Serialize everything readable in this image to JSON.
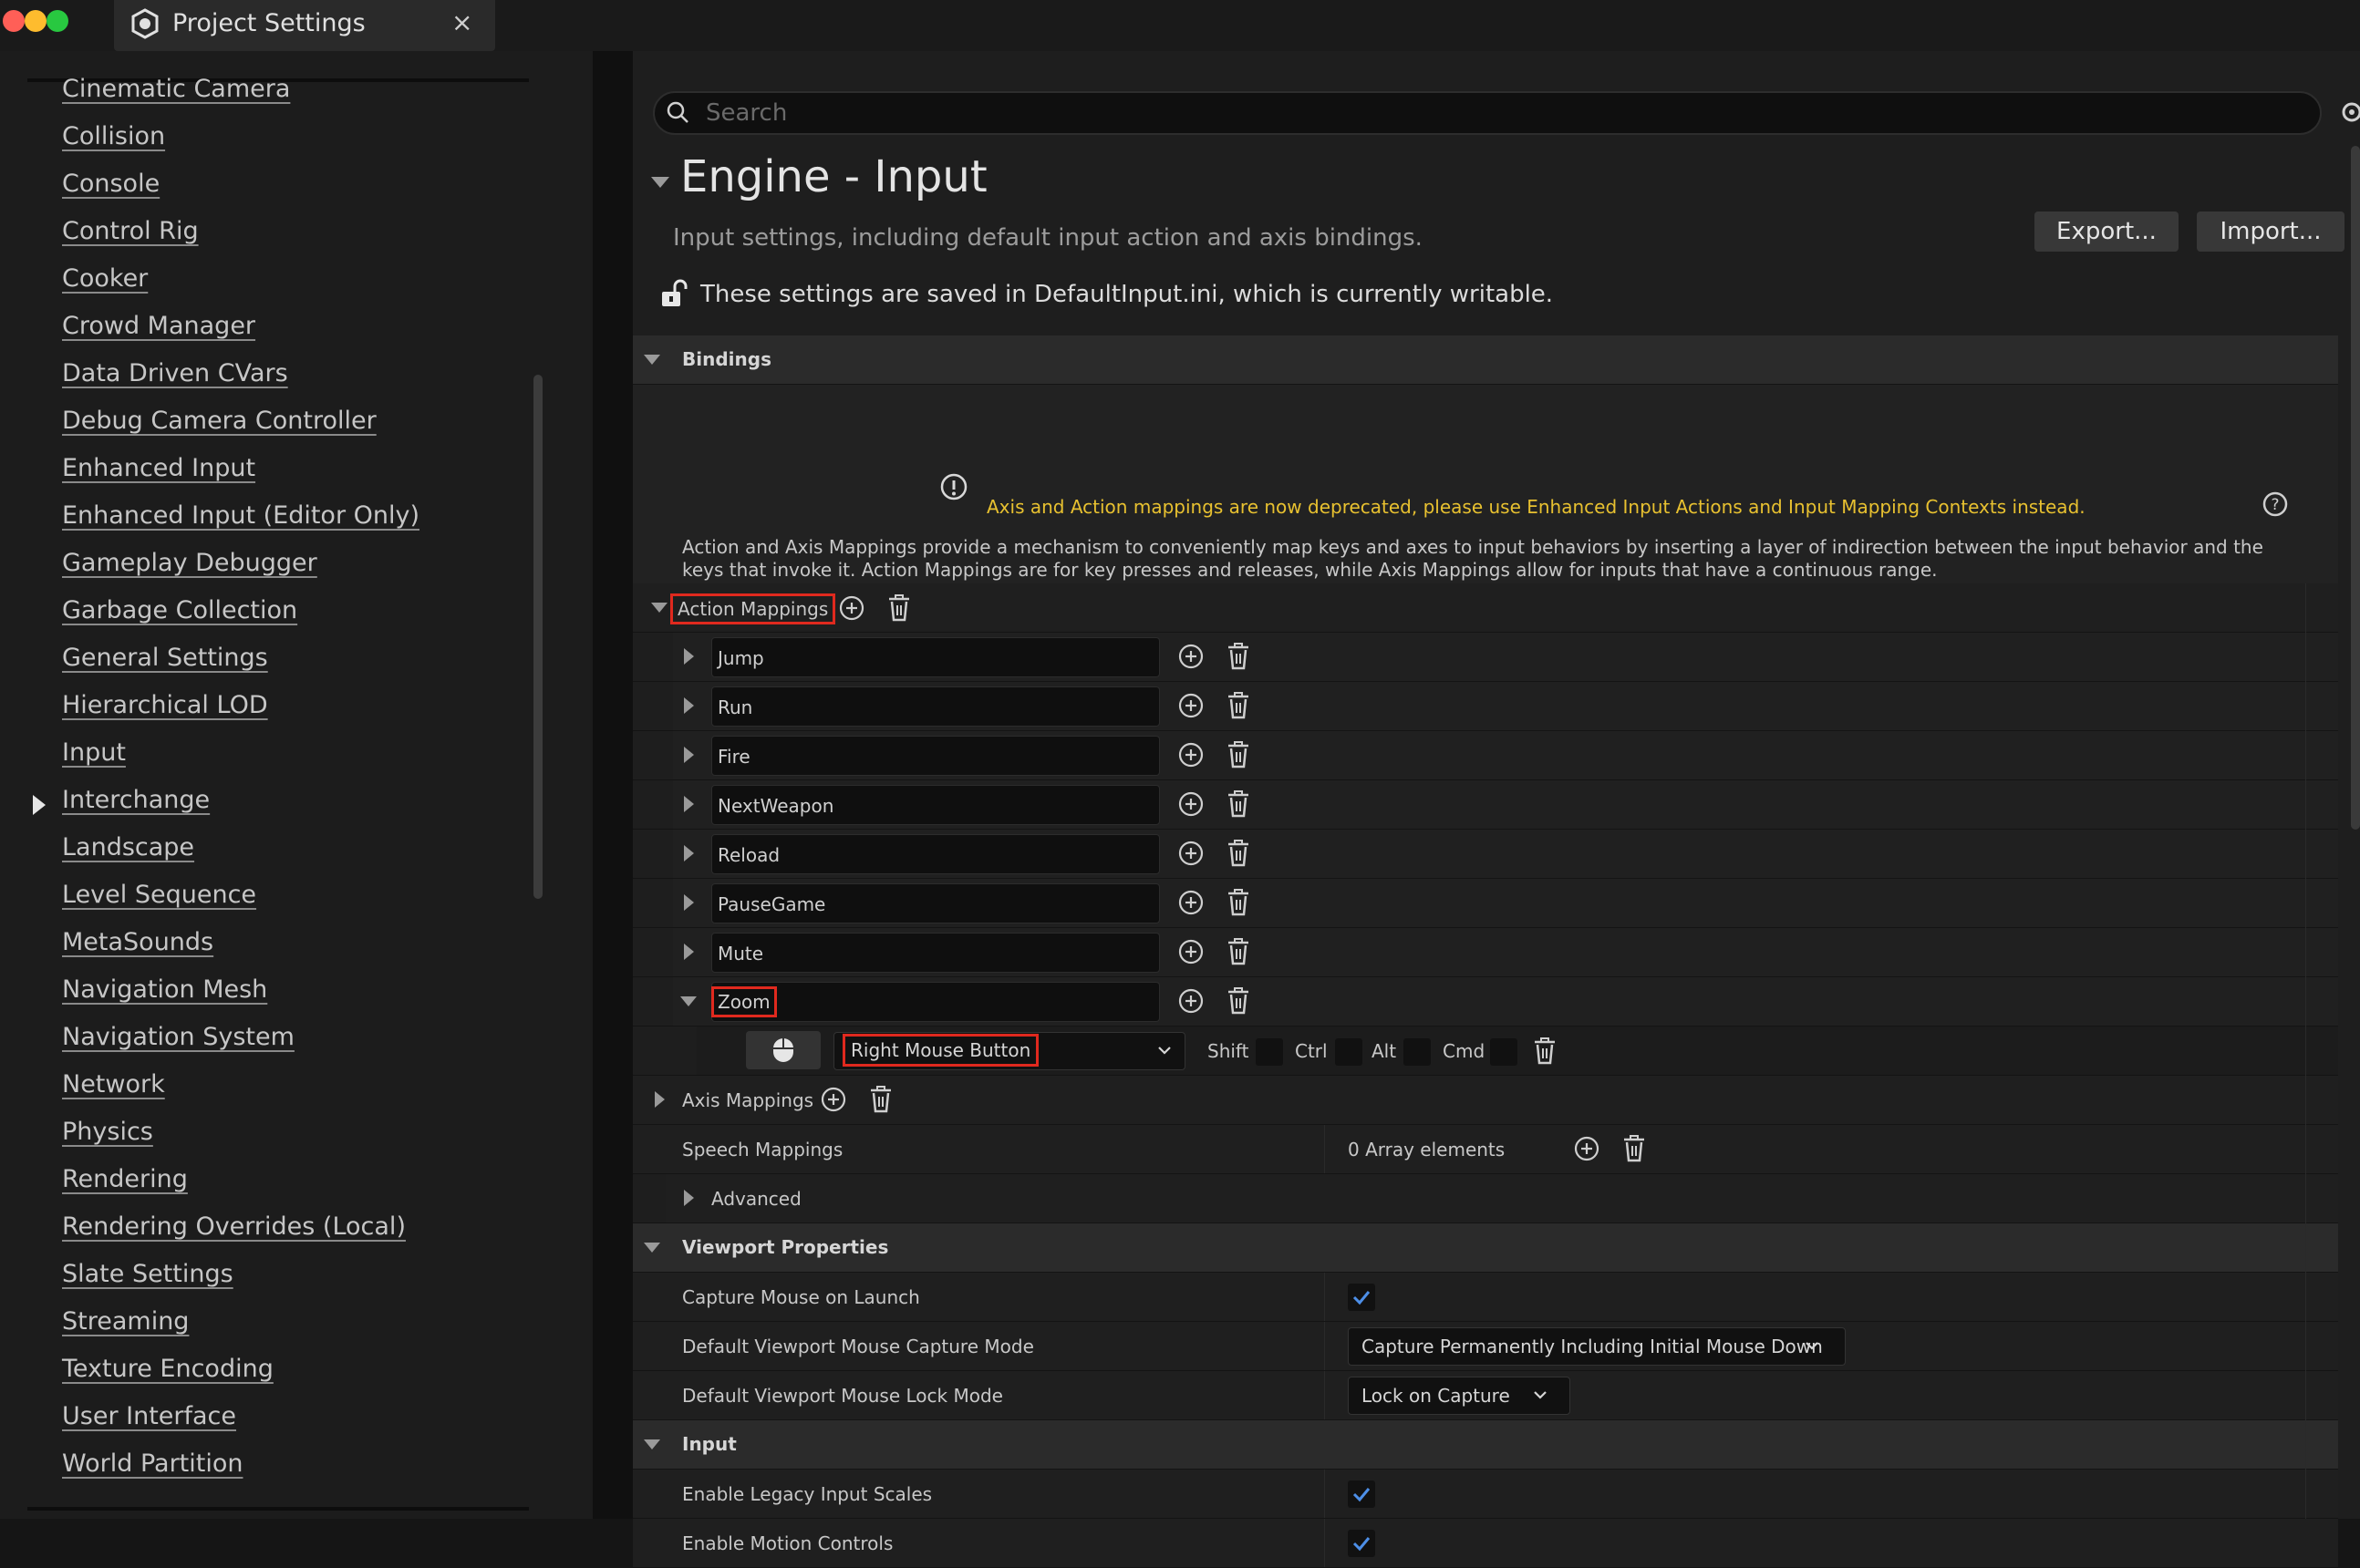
{
  "window": {
    "tab_title": "Project Settings",
    "close_glyph": "×",
    "colors": {
      "close": "#ff5f57",
      "minimize": "#febc2e",
      "maximize": "#28c840"
    }
  },
  "sidebar": {
    "items": [
      {
        "label": "Cinematic Camera"
      },
      {
        "label": "Collision"
      },
      {
        "label": "Console"
      },
      {
        "label": "Control Rig"
      },
      {
        "label": "Cooker"
      },
      {
        "label": "Crowd Manager"
      },
      {
        "label": "Data Driven CVars"
      },
      {
        "label": "Debug Camera Controller"
      },
      {
        "label": "Enhanced Input"
      },
      {
        "label": "Enhanced Input (Editor Only)"
      },
      {
        "label": "Gameplay Debugger"
      },
      {
        "label": "Garbage Collection"
      },
      {
        "label": "General Settings"
      },
      {
        "label": "Hierarchical LOD"
      },
      {
        "label": "Input"
      },
      {
        "label": "Interchange"
      },
      {
        "label": "Landscape"
      },
      {
        "label": "Level Sequence"
      },
      {
        "label": "MetaSounds"
      },
      {
        "label": "Navigation Mesh"
      },
      {
        "label": "Navigation System"
      },
      {
        "label": "Network"
      },
      {
        "label": "Physics"
      },
      {
        "label": "Rendering"
      },
      {
        "label": "Rendering Overrides (Local)"
      },
      {
        "label": "Slate Settings"
      },
      {
        "label": "Streaming"
      },
      {
        "label": "Texture Encoding"
      },
      {
        "label": "User Interface"
      },
      {
        "label": "World Partition"
      }
    ],
    "selected": "Input"
  },
  "search": {
    "placeholder": "Search"
  },
  "header": {
    "title": "Engine - Input",
    "subtitle": "Input settings, including default input action and axis bindings.",
    "export_label": "Export...",
    "import_label": "Import...",
    "writable_text": "These settings are saved in DefaultInput.ini, which is currently writable."
  },
  "bindings": {
    "category": "Bindings",
    "warning": "Axis and Action mappings are now deprecated, please use Enhanced Input Actions and Input Mapping Contexts instead.",
    "warning_color": "#e8c130",
    "description": "Action and Axis Mappings provide a mechanism to conveniently map keys and axes to input behaviors by inserting a layer of indirection between the input behavior and the keys that invoke it. Action Mappings are for key presses and releases, while Axis Mappings allow for inputs that have a continuous range.",
    "action_mappings_label": "Action Mappings",
    "actions": [
      {
        "name": "Jump"
      },
      {
        "name": "Run"
      },
      {
        "name": "Fire"
      },
      {
        "name": "NextWeapon"
      },
      {
        "name": "Reload"
      },
      {
        "name": "PauseGame"
      },
      {
        "name": "Mute"
      },
      {
        "name": "Zoom"
      }
    ],
    "zoom_key": {
      "key": "Right Mouse Button",
      "icon": "mouse-icon",
      "modifiers": {
        "shift": "Shift",
        "ctrl": "Ctrl",
        "alt": "Alt",
        "cmd": "Cmd"
      }
    },
    "axis_mappings_label": "Axis Mappings",
    "speech_mappings_label": "Speech Mappings",
    "speech_mappings_value": "0 Array elements",
    "advanced_label": "Advanced"
  },
  "viewport": {
    "category": "Viewport Properties",
    "capture_mouse_label": "Capture Mouse on Launch",
    "capture_mouse_checked": true,
    "capture_mode_label": "Default Viewport Mouse Capture Mode",
    "capture_mode_value": "Capture Permanently Including Initial Mouse Down",
    "lock_mode_label": "Default Viewport Mouse Lock Mode",
    "lock_mode_value": "Lock on Capture"
  },
  "input": {
    "category": "Input",
    "legacy_scales_label": "Enable Legacy Input Scales",
    "legacy_scales_checked": true,
    "motion_controls_label": "Enable Motion Controls",
    "motion_controls_checked": true
  },
  "accent_colors": {
    "checkmark": "#4d8fe8",
    "highlight": "#e0291e"
  }
}
